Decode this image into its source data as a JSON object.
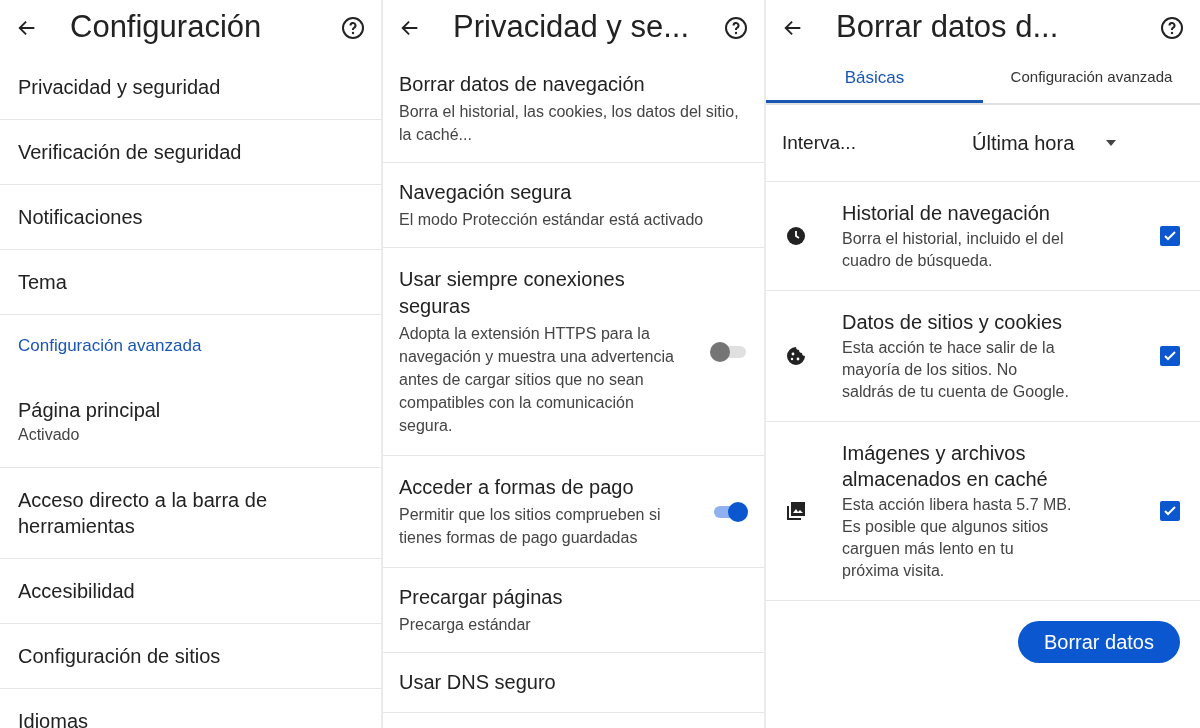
{
  "screens": [
    {
      "title": "Configuración",
      "items": [
        {
          "kind": "item",
          "title": "Privacidad y seguridad"
        },
        {
          "kind": "item",
          "title": "Verificación de seguridad"
        },
        {
          "kind": "item",
          "title": "Notificaciones"
        },
        {
          "kind": "item",
          "title": "Tema"
        },
        {
          "kind": "section",
          "title": "Configuración avanzada"
        },
        {
          "kind": "item",
          "title": "Página principal",
          "subtitle": "Activado"
        },
        {
          "kind": "item",
          "title": "Acceso directo a la barra de herramientas"
        },
        {
          "kind": "item",
          "title": "Accesibilidad"
        },
        {
          "kind": "item",
          "title": "Configuración de sitios"
        },
        {
          "kind": "item",
          "title": "Idiomas"
        }
      ]
    },
    {
      "title": "Privacidad y se...",
      "items": [
        {
          "kind": "item",
          "title": "Borrar datos de navegación",
          "subtitle": "Borra el historial, las cookies, los datos del sitio, la caché..."
        },
        {
          "kind": "item",
          "title": "Navegación segura",
          "subtitle": "El modo Protección estándar está activado"
        },
        {
          "kind": "toggle",
          "title": "Usar siempre conexiones seguras",
          "subtitle": "Adopta la extensión HTTPS para la navegación y muestra una advertencia antes de cargar sitios que no sean compatibles con la comunicación segura.",
          "on": false
        },
        {
          "kind": "toggle",
          "title": "Acceder a formas de pago",
          "subtitle": "Permitir que los sitios comprueben si tienes formas de pago guardadas",
          "on": true
        },
        {
          "kind": "item",
          "title": "Precargar páginas",
          "subtitle": "Precarga estándar"
        },
        {
          "kind": "item",
          "title": "Usar DNS seguro"
        }
      ]
    },
    {
      "title": "Borrar datos d...",
      "tabs": [
        {
          "label": "Básicas",
          "selected": true
        },
        {
          "label": "Configuración avanzada",
          "selected": false
        }
      ],
      "interval": {
        "label": "Interva...",
        "value": "Última hora"
      },
      "options": [
        {
          "title": "Historial de navegación",
          "subtitle": "Borra el historial, incluido el del cuadro de búsqueda.",
          "checked": true
        },
        {
          "title": "Datos de sitios y cookies",
          "subtitle": "Esta acción te hace salir de la mayoría de los sitios. No saldrás de tu cuenta de Google.",
          "checked": true
        },
        {
          "title": "Imágenes y archivos almacenados en caché",
          "subtitle": "Esta acción libera hasta 5.7 MB. Es posible que algunos sitios carguen más lento en tu próxima visita.",
          "checked": true
        }
      ],
      "button": "Borrar datos"
    }
  ]
}
